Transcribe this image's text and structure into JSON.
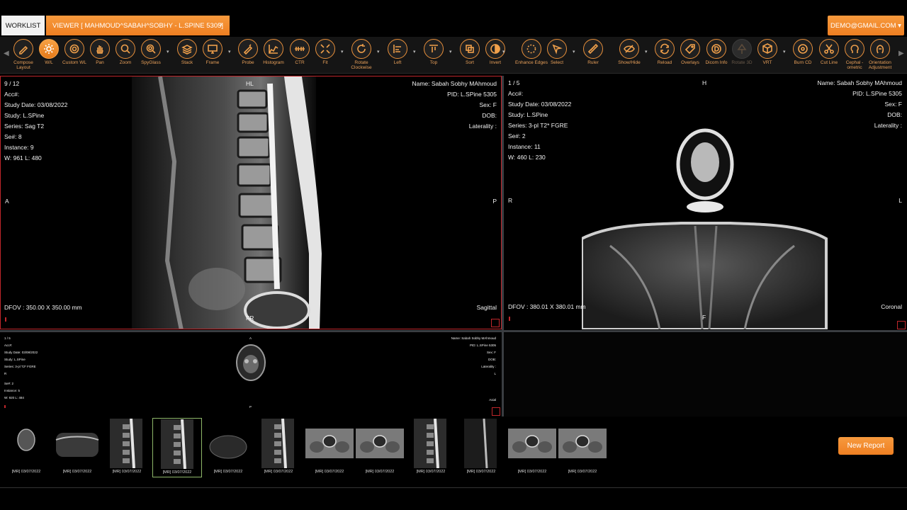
{
  "tabs": {
    "worklist": "WORKLIST",
    "viewer": "VIEWER [ MAHMOUD^SABAH^SOBHY - L.SPINE 5305]",
    "close": "×",
    "user": "DEMO@GMAIL.COM ▾"
  },
  "toolbar": {
    "tools": [
      {
        "label": "Compose Layout",
        "icon": "pencil-icon"
      },
      {
        "label": "W/L",
        "icon": "sun-icon"
      },
      {
        "label": "Custom WL",
        "icon": "gear-icon"
      },
      {
        "label": "Pan",
        "icon": "hand-icon"
      },
      {
        "label": "Zoom",
        "icon": "zoom-icon"
      },
      {
        "label": "SpyGlass",
        "icon": "spyglass-icon"
      },
      {
        "label": "Stack",
        "icon": "stack-icon"
      },
      {
        "label": "Frame",
        "icon": "monitor-icon"
      },
      {
        "label": "Probe",
        "icon": "probe-icon"
      },
      {
        "label": "Histogram",
        "icon": "histogram-icon"
      },
      {
        "label": "CTR",
        "icon": "ctr-icon"
      },
      {
        "label": "Fit",
        "icon": "fit-icon"
      },
      {
        "label": "Rotate Clockwise",
        "icon": "rotate-icon"
      },
      {
        "label": "Left",
        "icon": "align-left-icon"
      },
      {
        "label": "Top",
        "icon": "align-top-icon"
      },
      {
        "label": "Sort",
        "icon": "sort-icon"
      },
      {
        "label": "Invert",
        "icon": "invert-icon"
      },
      {
        "label": "Enhance Edges",
        "icon": "enhance-icon"
      },
      {
        "label": "Select",
        "icon": "select-icon"
      },
      {
        "label": "Ruler",
        "icon": "ruler-icon"
      },
      {
        "label": "Show/Hide",
        "icon": "eye-slash-icon"
      },
      {
        "label": "Reload",
        "icon": "reload-icon"
      },
      {
        "label": "Overlays",
        "icon": "tag-icon"
      },
      {
        "label": "Dicom Info",
        "icon": "dicom-icon"
      },
      {
        "label": "Rotate 3D",
        "icon": "tree-icon"
      },
      {
        "label": "VRT",
        "icon": "cube-icon"
      },
      {
        "label": "Burn CD",
        "icon": "cd-icon"
      },
      {
        "label": "Cut Line",
        "icon": "scissors-icon"
      },
      {
        "label": "Cephal - ometric",
        "icon": "head-icon"
      },
      {
        "label": "Orientation Adjustment",
        "icon": "orientation-icon"
      }
    ]
  },
  "viewport1": {
    "image_index": "9 / 12",
    "acc": "Acc#:",
    "study_date": "Study Date: 03/08/2022",
    "study": "Study: L.SPine",
    "series": "Series: Sag T2",
    "se_num": "Se#: 8",
    "instance": "Instance: 9",
    "wl": "W: 961 L: 480",
    "name": "Name: Sabah Sobhy MAhmoud",
    "pid": "PID: L.SPine 5305",
    "sex": "Sex: F",
    "dob": "DOB:",
    "laterality": "Laterality :",
    "orient_top": "HL",
    "orient_left": "A",
    "orient_right": "P",
    "orient_bottom": "FR",
    "dfov": "DFOV : 350.00 X 350.00 mm",
    "plane": "Sagittal"
  },
  "viewport2": {
    "image_index": "1 / 5",
    "acc": "Acc#:",
    "study_date": "Study Date: 03/08/2022",
    "study": "Study: L.SPine",
    "series": "Series: 3-pl T2* FGRE",
    "se_num": "Se#: 2",
    "instance": "Instance: 11",
    "wl": "W: 460 L: 230",
    "name": "Name: Sabah Sobhy MAhmoud",
    "pid": "PID: L.SPine 5305",
    "sex": "Sex: F",
    "dob": "DOB:",
    "laterality": "Laterality :",
    "orient_top": "H",
    "orient_left": "R",
    "orient_right": "L",
    "orient_bottom": "F",
    "dfov": "DFOV : 380.01 X 380.01 mm",
    "plane": "Coronal"
  },
  "viewport3": {
    "image_index": "1 / 5",
    "acc": "Acc#:",
    "study_date": "Study Date: 03/08/2022",
    "study": "Study: L.SPine",
    "series": "Series: 3-pl T2* FGRE",
    "orient_left": "R",
    "se_num": "Se#: 2",
    "instance": "Instance: 5",
    "wl": "W: 920 L: 484",
    "name": "Name: Sabah Sobhy MAhmoud",
    "pid": "PID: L.SPine 5305",
    "sex": "Sex: F",
    "dob": "DOB:",
    "laterality": "Laterality :",
    "orient_right": "L",
    "orient_top": "A",
    "orient_bottom": "P",
    "plane": "Axial"
  },
  "thumbnails": [
    {
      "caption": "[MR] 03/07/2022",
      "kind": "axial"
    },
    {
      "caption": "[MR] 03/07/2022",
      "kind": "coronal"
    },
    {
      "caption": "[MR] 03/07/2022",
      "kind": "sagittal"
    },
    {
      "caption": "[MR] 03/07/2022",
      "kind": "sagittal"
    },
    {
      "caption": "[MR] 03/07/2022",
      "kind": "faint"
    },
    {
      "caption": "[MR] 03/07/2022",
      "kind": "sagittal"
    },
    {
      "caption": "[MR] 03/07/2022",
      "kind": "pelvis"
    },
    {
      "caption": "[MR] 03/07/2022",
      "kind": "pelvis"
    },
    {
      "caption": "[MR] 03/07/2022",
      "kind": "sagittal"
    },
    {
      "caption": "[MR] 03/07/2022",
      "kind": "sagittal-dark"
    },
    {
      "caption": "[MR] 03/07/2022",
      "kind": "pelvis"
    },
    {
      "caption": "[MR] 03/07/2022",
      "kind": "pelvis"
    }
  ],
  "new_report": "New Report"
}
